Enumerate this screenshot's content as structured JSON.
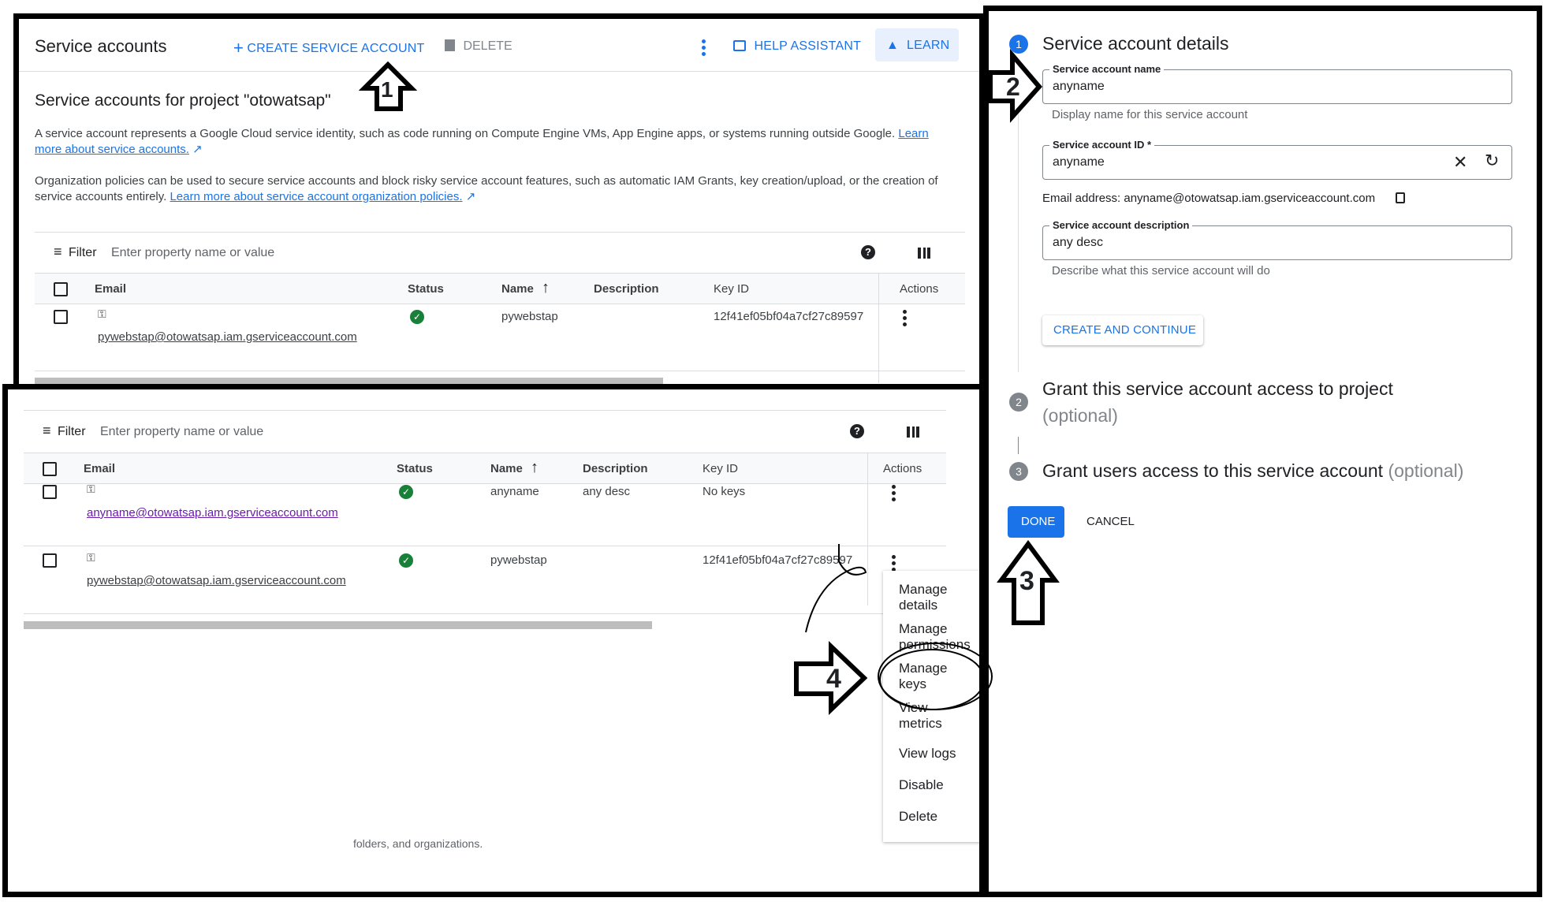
{
  "top": {
    "title": "Service accounts",
    "create_label": "CREATE SERVICE ACCOUNT",
    "delete_label": "DELETE",
    "help_label": "HELP ASSISTANT",
    "learn_label": "LEARN",
    "heading": "Service accounts for project \"otowatsap\"",
    "desc1_text": "A service account represents a Google Cloud service identity, such as code running on Compute Engine VMs, App Engine apps, or systems running outside Google.",
    "desc1_link_a": "Learn",
    "desc1_link_b": "more about service accounts.",
    "desc2_text": "Organization policies can be used to secure service accounts and block risky service account features, such as automatic IAM Grants, key creation/upload, or the creation of",
    "desc2_text_b": "service accounts entirely.",
    "desc2_link": "Learn more about service account organization policies.",
    "filter_label": "Filter",
    "filter_placeholder": "Enter property name or value",
    "columns": [
      "Email",
      "Status",
      "Name",
      "Description",
      "Key ID",
      "Actions"
    ],
    "row": {
      "email": "pywebstap@otowatsap.iam.gserviceaccount.com",
      "name": "pywebstap",
      "key_id": "12f41ef05bf04a7cf27c89597"
    }
  },
  "bottom": {
    "filter_label": "Filter",
    "filter_placeholder": "Enter property name or value",
    "columns": [
      "Email",
      "Status",
      "Name",
      "Description",
      "Key ID",
      "Actions"
    ],
    "rows": [
      {
        "email": "anyname@otowatsap.iam.gserviceaccount.com",
        "name": "anyname",
        "description": "any desc",
        "key_id": "No keys"
      },
      {
        "email": "pywebstap@otowatsap.iam.gserviceaccount.com",
        "name": "pywebstap",
        "description": "",
        "key_id": "12f41ef05bf04a7cf27c89597"
      }
    ],
    "menu": [
      "Manage details",
      "Manage permissions",
      "Manage keys",
      "View metrics",
      "View logs",
      "Disable",
      "Delete"
    ],
    "footer_fragment": "folders, and organizations."
  },
  "right": {
    "step1_num": "1",
    "step1_title": "Service account details",
    "name_label": "Service account name",
    "name_value": "anyname",
    "name_hint": "Display name for this service account",
    "id_label": "Service account ID *",
    "id_value": "anyname",
    "email_line": "Email address: anyname@otowatsap.iam.gserviceaccount.com",
    "desc_label": "Service account description",
    "desc_value": "any desc",
    "desc_hint": "Describe what this service account will do",
    "create_continue": "CREATE AND CONTINUE",
    "step2_num": "2",
    "step2_title": "Grant this service account access to project",
    "step2_optional": "(optional)",
    "step3_num": "3",
    "step3_title": "Grant users access to this service account",
    "step3_optional": "(optional)",
    "done_label": "DONE",
    "cancel_label": "CANCEL"
  },
  "annotations": {
    "a1": "1",
    "a2": "2",
    "a3": "3",
    "a4": "4"
  },
  "colors": {
    "accent": "#1a73e8",
    "done_bg": "#1a73e8",
    "ok": "#188038",
    "border": "#000000"
  }
}
